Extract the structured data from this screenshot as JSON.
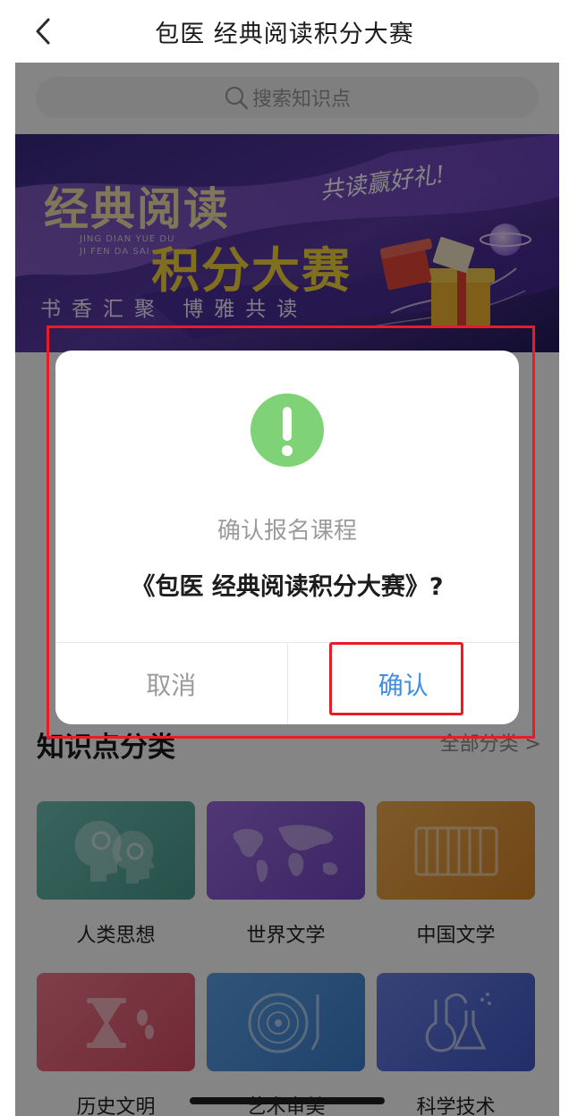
{
  "header": {
    "title": "包医 经典阅读积分大赛",
    "back_icon": "chevron-left-icon"
  },
  "search": {
    "placeholder": "搜索知识点",
    "icon": "search-icon"
  },
  "banner": {
    "title_line1": "经典阅读",
    "pinyin_line1": "JING DIAN YUE DU",
    "pinyin_line2": "JI FEN DA SAI",
    "title_line2": "积分大赛",
    "slogan": "共读赢好礼!",
    "subtitle": "书香汇聚 博雅共读"
  },
  "categories": {
    "title": "知识点分类",
    "all_label": "全部分类 >",
    "items": [
      {
        "label": "人类思想",
        "icon": "heads-gears-icon",
        "color": "#5fb0a6"
      },
      {
        "label": "世界文学",
        "icon": "world-map-icon",
        "color": "#8a5bd0"
      },
      {
        "label": "中国文学",
        "icon": "bamboo-scroll-icon",
        "color": "#e59a3e"
      },
      {
        "label": "历史文明",
        "icon": "hourglass-icon",
        "color": "#e65f77"
      },
      {
        "label": "艺术审美",
        "icon": "vinyl-record-icon",
        "color": "#4a8fd6"
      },
      {
        "label": "科学技术",
        "icon": "lab-flask-icon",
        "color": "#4b67d2"
      }
    ]
  },
  "dialog": {
    "icon": "exclamation-icon",
    "icon_color": "#7fd376",
    "message": "确认报名课程",
    "course_name": "《包医 经典阅读积分大赛》?",
    "cancel_label": "取消",
    "confirm_label": "确认",
    "confirm_color": "#3d8ee4"
  },
  "annotation_color": "#ea1b25"
}
